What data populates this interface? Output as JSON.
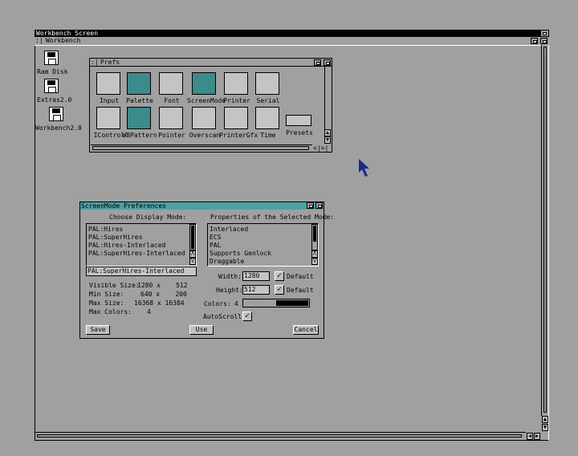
{
  "screen": {
    "title": "Workbench Screen",
    "window_title": "Workbench"
  },
  "desktop_icons": [
    {
      "label": "Ram Disk",
      "icon": "disk-icon"
    },
    {
      "label": "Extras2.0",
      "icon": "floppy-icon"
    },
    {
      "label": "Workbench2.0",
      "icon": "floppy-icon"
    }
  ],
  "prefs": {
    "title": "Prefs",
    "row1": [
      "Input",
      "Palette",
      "Font",
      "ScreenMode",
      "Printer",
      "Serial"
    ],
    "row2": [
      "IControl",
      "WBPattern",
      "Pointer",
      "Overscan",
      "PrinterGfx",
      "Time"
    ],
    "presets": "Presets",
    "scroll_arrows": "<|>|"
  },
  "screenmode": {
    "title": "ScreenMode Preferences",
    "choose_label": "Choose Display Mode:",
    "modes": [
      "PAL:Hires",
      "PAL:SuperHires",
      "PAL:Hires-Interlaced",
      "PAL:SuperHires-Interlaced"
    ],
    "selected_mode": "PAL:SuperHires-Interlaced",
    "properties_label": "Properties of the Selected Mode:",
    "properties": [
      "Interlaced",
      "ECS",
      "PAL",
      "Supports Genlock",
      "Draggable"
    ],
    "info": [
      {
        "label": "Visible Size:",
        "value": "1280 x    512"
      },
      {
        "label": "Min Size:",
        "value": "640 x    200"
      },
      {
        "label": "Max Size:",
        "value": "16368 x 16384"
      },
      {
        "label": "Max Colors:",
        "value": "4"
      }
    ],
    "width_label": "Width:",
    "width_value": "1280",
    "height_label": "Height:",
    "height_value": "512",
    "default_label": "Default",
    "colors_label": "Colors:",
    "colors_value": "4",
    "colors_level": 0.5,
    "autoscroll_label": "AutoScroll:",
    "save_label": "Save",
    "use_label": "Use",
    "cancel_label": "Cancel",
    "check_mark": "✓",
    "up_arrow": "Λ",
    "down_arrow": "V"
  },
  "colors": {
    "desktop": "#a0a0a0",
    "title_teal": "#4fa0a0",
    "pointer": "#1a2a88"
  }
}
